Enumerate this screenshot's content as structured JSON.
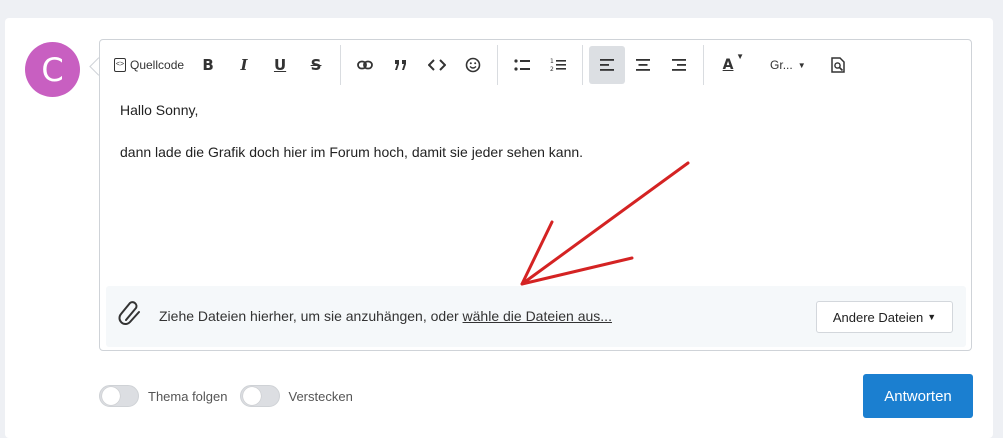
{
  "avatar": {
    "initial": "C",
    "color": "#c85fc1"
  },
  "toolbar": {
    "source_label": "Quellcode",
    "bold_label": "B",
    "italic_label": "I",
    "underline_label": "U",
    "strike_label": "S",
    "font_label": "Gr...",
    "text_color_label": "A",
    "icons": [
      "source-code-icon",
      "link-icon",
      "quote-icon",
      "code-icon",
      "emoji-icon",
      "bullet-list-icon",
      "numbered-list-icon",
      "align-left-icon",
      "align-center-icon",
      "align-right-icon",
      "text-color-icon",
      "font-size",
      "preview-icon"
    ]
  },
  "content": {
    "line1": "Hallo Sonny,",
    "line2": "dann lade die Grafik doch hier im Forum hoch, damit sie jeder sehen kann."
  },
  "dropzone": {
    "text": "Ziehe Dateien hierher, um sie anzuhängen, oder ",
    "link": "wähle die Dateien aus...",
    "other_button": "Andere Dateien"
  },
  "footer": {
    "toggle1_label": "Thema folgen",
    "toggle2_label": "Verstecken",
    "reply_button": "Antworten"
  },
  "colors": {
    "accent": "#1b7fd0",
    "annotation_arrow": "#d42323"
  }
}
